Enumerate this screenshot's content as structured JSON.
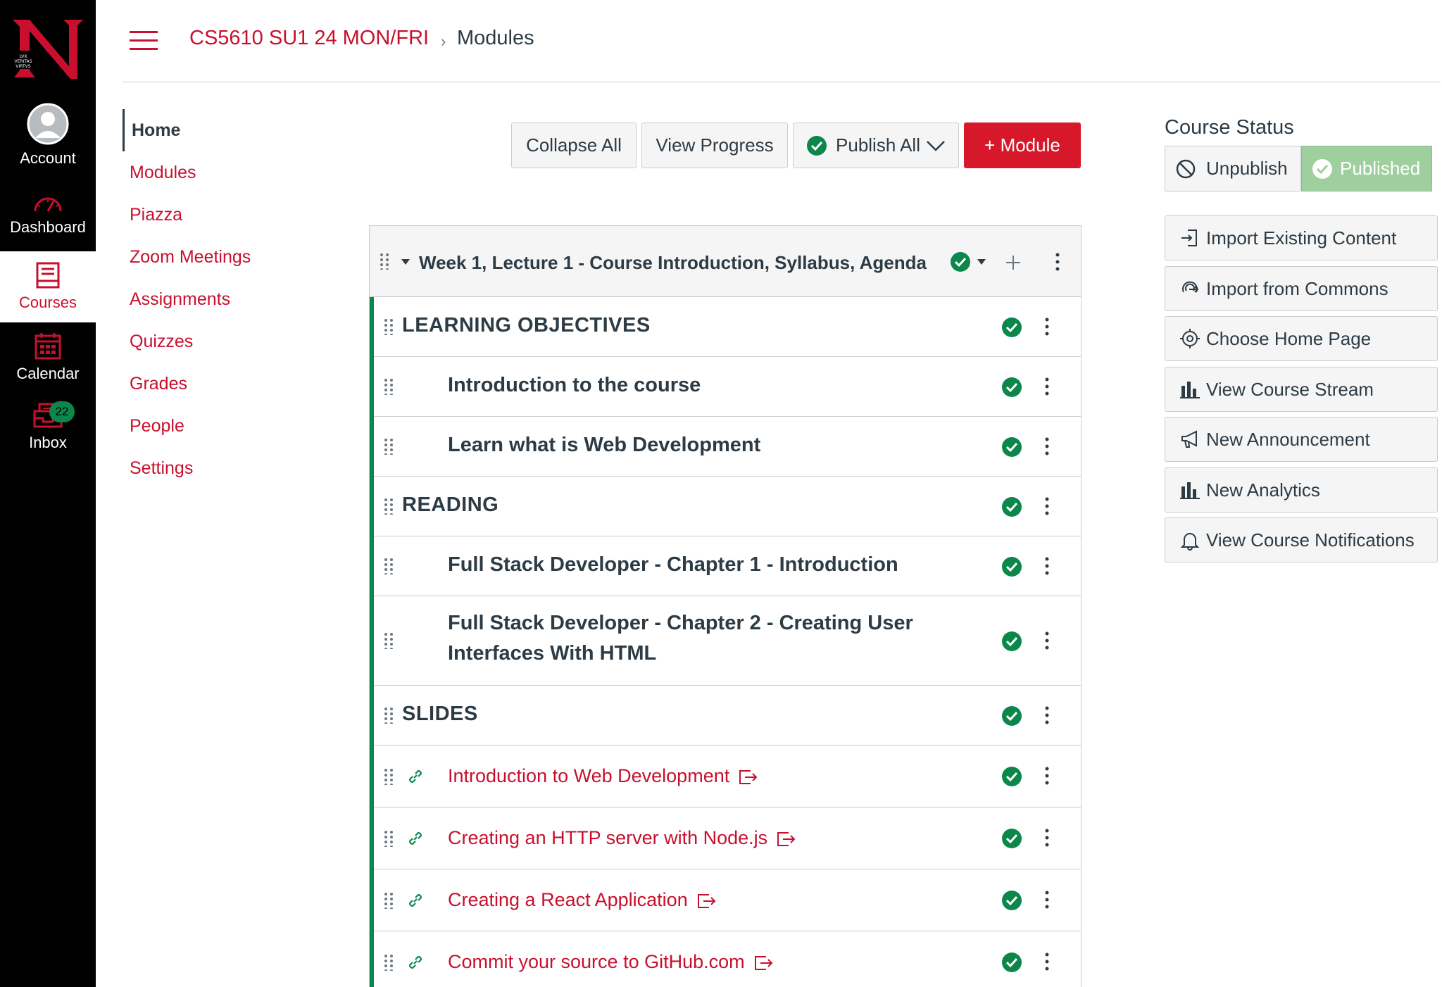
{
  "global_nav": {
    "account": "Account",
    "dashboard": "Dashboard",
    "courses": "Courses",
    "calendar": "Calendar",
    "inbox": "Inbox",
    "inbox_badge": "22",
    "accent_color": "#c8102e"
  },
  "breadcrumb": {
    "course": "CS5610 SU1 24 MON/FRI",
    "separator": "›",
    "current": "Modules"
  },
  "course_nav": [
    {
      "label": "Home",
      "active": true
    },
    {
      "label": "Modules"
    },
    {
      "label": "Piazza"
    },
    {
      "label": "Zoom Meetings"
    },
    {
      "label": "Assignments"
    },
    {
      "label": "Quizzes"
    },
    {
      "label": "Grades"
    },
    {
      "label": "People"
    },
    {
      "label": "Settings"
    }
  ],
  "toolbar": {
    "collapse_all": "Collapse All",
    "view_progress": "View Progress",
    "publish_all": "Publish All",
    "add_module": "+ Module"
  },
  "module": {
    "title": "Week 1, Lecture 1 - Course Introduction, Syllabus, Agenda",
    "items": [
      {
        "type": "header",
        "title": "LEARNING OBJECTIVES"
      },
      {
        "type": "text",
        "title": "Introduction to the course"
      },
      {
        "type": "text",
        "title": "Learn what is Web Development"
      },
      {
        "type": "header",
        "title": "READING"
      },
      {
        "type": "text",
        "title": "Full Stack Developer - Chapter 1 - Introduction"
      },
      {
        "type": "text",
        "title_line1": "Full Stack Developer - Chapter 2 - Creating User",
        "title_line2": "Interfaces With HTML"
      },
      {
        "type": "header",
        "title": "SLIDES"
      },
      {
        "type": "link",
        "title": "Introduction to Web Development"
      },
      {
        "type": "link",
        "title": "Creating an HTTP server with Node.js"
      },
      {
        "type": "link",
        "title": "Creating a React Application"
      },
      {
        "type": "link",
        "title": "Commit your source to GitHub.com"
      }
    ]
  },
  "sidebar": {
    "course_status_title": "Course Status",
    "unpublish": "Unpublish",
    "published": "Published",
    "buttons": [
      {
        "label": "Import Existing Content",
        "icon": "import-icon"
      },
      {
        "label": "Import from Commons",
        "icon": "commons-icon"
      },
      {
        "label": "Choose Home Page",
        "icon": "target-icon"
      },
      {
        "label": "View Course Stream",
        "icon": "bar-chart-icon"
      },
      {
        "label": "New Announcement",
        "icon": "megaphone-icon"
      },
      {
        "label": "New Analytics",
        "icon": "bar-chart-icon"
      },
      {
        "label": "View Course Notifications",
        "icon": "bell-icon"
      }
    ]
  }
}
